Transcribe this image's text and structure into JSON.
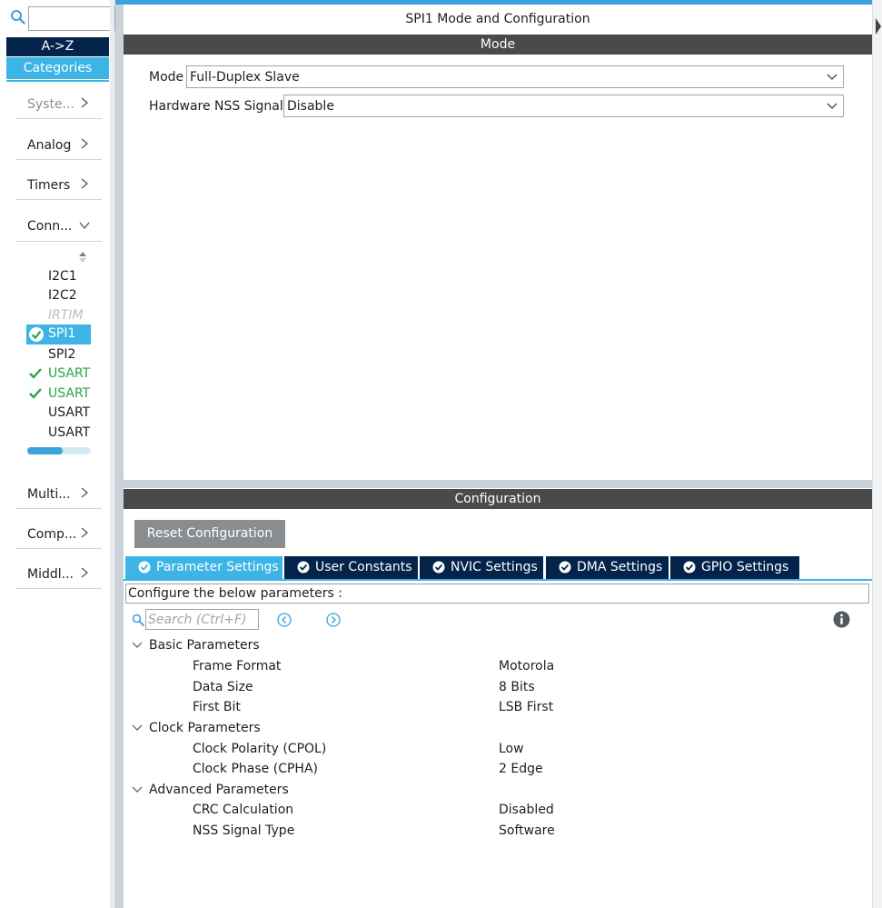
{
  "sidebar": {
    "search_value": "",
    "sort_az_label": "A->Z",
    "categories_label": "Categories",
    "categories": [
      {
        "label": "Syste...",
        "expanded": false,
        "dimmed": true
      },
      {
        "label": "Analog",
        "expanded": false
      },
      {
        "label": "Timers",
        "expanded": false
      },
      {
        "label": "Conn...",
        "expanded": true
      },
      {
        "label": "Multi...",
        "expanded": false
      },
      {
        "label": "Comp...",
        "expanded": false
      },
      {
        "label": "Middl...",
        "expanded": false
      }
    ],
    "peripherals": [
      {
        "label": "I2C1",
        "state": "normal"
      },
      {
        "label": "I2C2",
        "state": "normal"
      },
      {
        "label": "IRTIM",
        "state": "disabled"
      },
      {
        "label": "SPI1",
        "state": "selected-configured"
      },
      {
        "label": "SPI2",
        "state": "normal"
      },
      {
        "label": "USART",
        "state": "configured"
      },
      {
        "label": "USART",
        "state": "configured"
      },
      {
        "label": "USART",
        "state": "normal"
      },
      {
        "label": "USART",
        "state": "normal"
      }
    ],
    "h_scroll_fraction": 0.55
  },
  "main": {
    "title": "SPI1 Mode and Configuration",
    "mode_section": {
      "header": "Mode",
      "fields": [
        {
          "label": "Mode",
          "value": "Full-Duplex Slave"
        },
        {
          "label": "Hardware NSS Signal",
          "value": "Disable"
        }
      ]
    },
    "config_section": {
      "header": "Configuration",
      "reset_label": "Reset Configuration",
      "tabs": [
        {
          "label": "Parameter Settings",
          "active": true
        },
        {
          "label": "User Constants",
          "active": false
        },
        {
          "label": "NVIC Settings",
          "active": false
        },
        {
          "label": "DMA Settings",
          "active": false
        },
        {
          "label": "GPIO Settings",
          "active": false
        }
      ],
      "hint": "Configure the below parameters :",
      "search_placeholder": "Search (Ctrl+F)",
      "groups": [
        {
          "label": "Basic Parameters",
          "params": [
            {
              "name": "Frame Format",
              "value": "Motorola"
            },
            {
              "name": "Data Size",
              "value": "8 Bits"
            },
            {
              "name": "First Bit",
              "value": "LSB First"
            }
          ]
        },
        {
          "label": "Clock Parameters",
          "params": [
            {
              "name": "Clock Polarity (CPOL)",
              "value": "Low"
            },
            {
              "name": "Clock Phase (CPHA)",
              "value": "2 Edge"
            }
          ]
        },
        {
          "label": "Advanced Parameters",
          "params": [
            {
              "name": "CRC Calculation",
              "value": "Disabled"
            },
            {
              "name": "NSS Signal Type",
              "value": "Software"
            }
          ]
        }
      ]
    }
  },
  "icons": {
    "search": "search-icon",
    "chevron_right": "chevron-right-icon",
    "chevron_down": "chevron-down-icon",
    "check": "check-icon",
    "info": "info-icon",
    "prev": "previous-icon",
    "next": "next-icon"
  },
  "colors": {
    "accent": "#3cb4e6",
    "navy": "#03234b",
    "section_bar": "#4a4a4a",
    "configured_green": "#2aa44a",
    "reset_button": "#8a8d90"
  }
}
